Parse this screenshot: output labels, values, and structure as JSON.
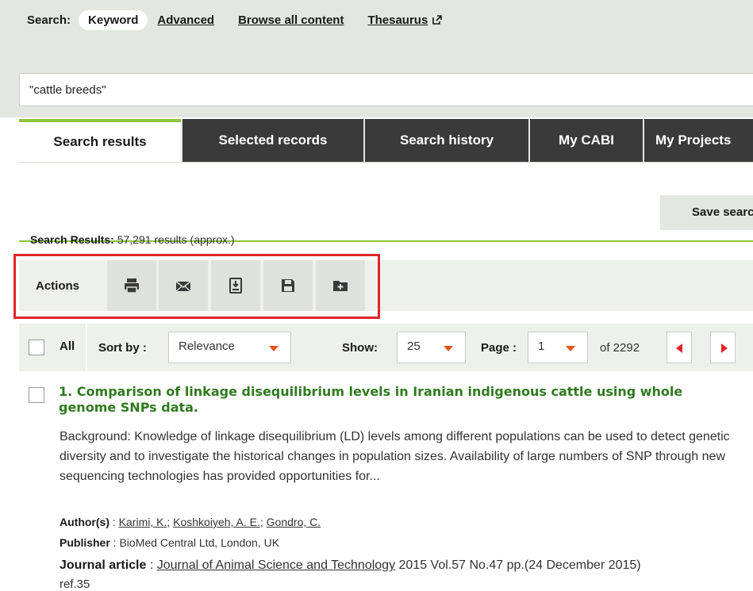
{
  "search_modes": {
    "label": "Search:",
    "keyword": "Keyword",
    "advanced": "Advanced",
    "browse": "Browse all content",
    "thesaurus": "Thesaurus"
  },
  "search": {
    "query": "\"cattle breeds\""
  },
  "tabs": [
    {
      "label": "Search results",
      "active": true
    },
    {
      "label": "Selected records"
    },
    {
      "label": "Search history"
    },
    {
      "label": "My CABI"
    },
    {
      "label": "My Projects"
    }
  ],
  "save_search_label": "Save search",
  "results": {
    "label": "Search Results:",
    "count": "57,291 results (approx.)"
  },
  "actions": {
    "label": "Actions",
    "icons": [
      "print-icon",
      "email-icon",
      "download-icon",
      "save-icon",
      "add-to-folder-icon"
    ]
  },
  "controls": {
    "all_label": "All",
    "sort_label": "Sort by :",
    "sort_value": "Relevance",
    "show_label": "Show:",
    "show_value": "25",
    "page_label": "Page :",
    "page_value": "1",
    "of_pages": "of 2292"
  },
  "record": {
    "title": "1. Comparison of linkage disequilibrium levels in Iranian indigenous cattle using whole genome SNPs data.",
    "abstract": "Background: Knowledge of linkage disequilibrium (LD) levels among different populations can be used to detect genetic diversity and to investigate the historical changes in population sizes. Availability of large numbers of SNP through new sequencing technologies has provided opportunities for...",
    "authors_label": "Author(s)",
    "authors": [
      "Karimi, K.",
      "Koshkoiyeh, A. E.",
      "Gondro, C."
    ],
    "publisher_label": "Publisher",
    "publisher": "BioMed Central Ltd, London, UK",
    "type_label": "Journal article",
    "journal": "Journal of Animal Science and Technology",
    "citation": "2015 Vol.57 No.47 pp.(24 December 2015)",
    "refs": "ref.35"
  },
  "colors": {
    "accent_green": "#8cc63f",
    "title_green": "#2f7a1f",
    "dark_tab": "#3a3a3a",
    "highlight_red": "#e2232a",
    "caret_orange": "#e8541a"
  }
}
